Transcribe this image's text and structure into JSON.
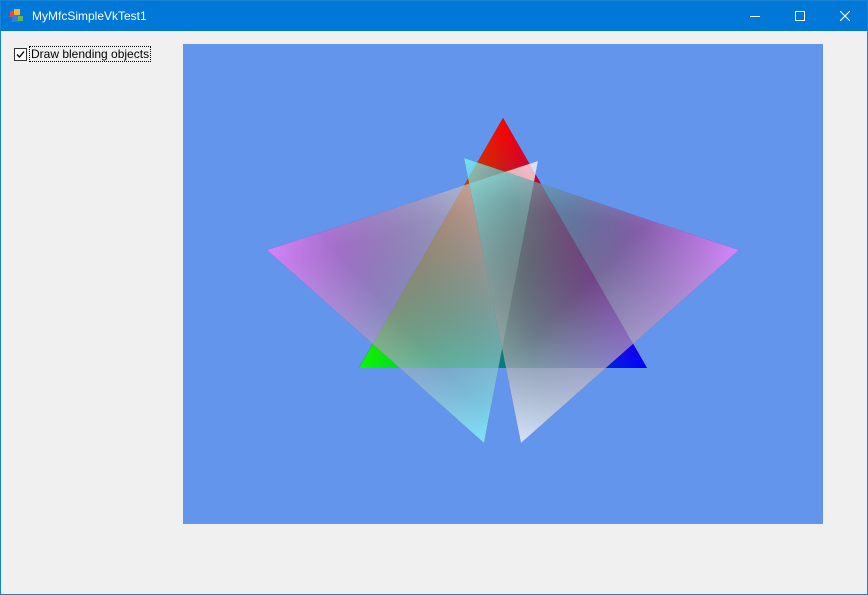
{
  "window": {
    "title": "MyMfcSimpleVkTest1",
    "icon": "app-icon",
    "controls": [
      "minimize-icon",
      "maximize-icon",
      "close-icon"
    ]
  },
  "options": {
    "blend_checkbox_label": "Draw blending objects",
    "blend_checkbox_checked": true
  },
  "viewport": {
    "background_color": "#6495ed",
    "objects": [
      {
        "name": "vertex-colored-triangle",
        "vertex_colors": [
          "#ff0000",
          "#00ff00",
          "#0000ff"
        ]
      },
      {
        "name": "blended-triangle-left",
        "vertex_colors": [
          "#ff80ff",
          "#ffffff",
          "#80ffff"
        ]
      },
      {
        "name": "blended-triangle-right",
        "vertex_colors": [
          "#80ffff",
          "#ffffff",
          "#ff80ff"
        ]
      }
    ]
  }
}
